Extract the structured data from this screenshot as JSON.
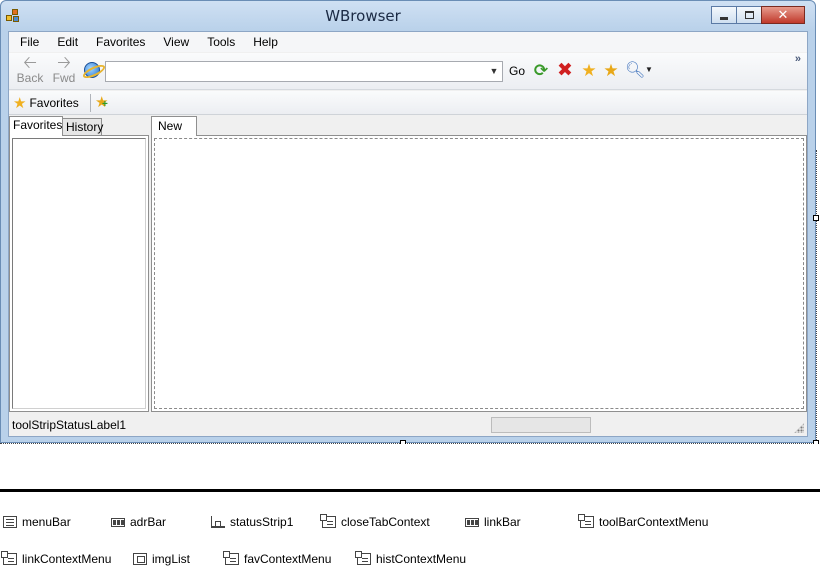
{
  "window": {
    "title": "WBrowser"
  },
  "menu": [
    "File",
    "Edit",
    "Favorites",
    "View",
    "Tools",
    "Help"
  ],
  "toolbar": {
    "back_label": "Back",
    "fwd_label": "Fwd",
    "address_value": "",
    "go_label": "Go",
    "overflow": "»"
  },
  "linkbar": {
    "favorites_label": "Favorites"
  },
  "left_tabs": [
    "Favorites",
    "History"
  ],
  "right_tabs": [
    "New"
  ],
  "status": {
    "label": "toolStripStatusLabel1",
    "progress": 0
  },
  "tray": {
    "row1": [
      "menuBar",
      "adrBar",
      "statusStrip1",
      "closeTabContext",
      "linkBar",
      "toolBarContextMenu"
    ],
    "row2": [
      "linkContextMenu",
      "imgList",
      "favContextMenu",
      "histContextMenu"
    ]
  },
  "icons": {
    "app": "app-icon",
    "back": "back-arrow-icon",
    "fwd": "forward-arrow-icon",
    "ie": "browser-globe-icon",
    "refresh": "refresh-icon",
    "stop": "stop-icon",
    "favorites": "star-icon",
    "add_favorite": "add-star-icon",
    "search": "magnifier-icon"
  },
  "colors": {
    "title_bar": "#b9d1ea",
    "close_button": "#c0392b",
    "progress_fill": "#06b025"
  }
}
